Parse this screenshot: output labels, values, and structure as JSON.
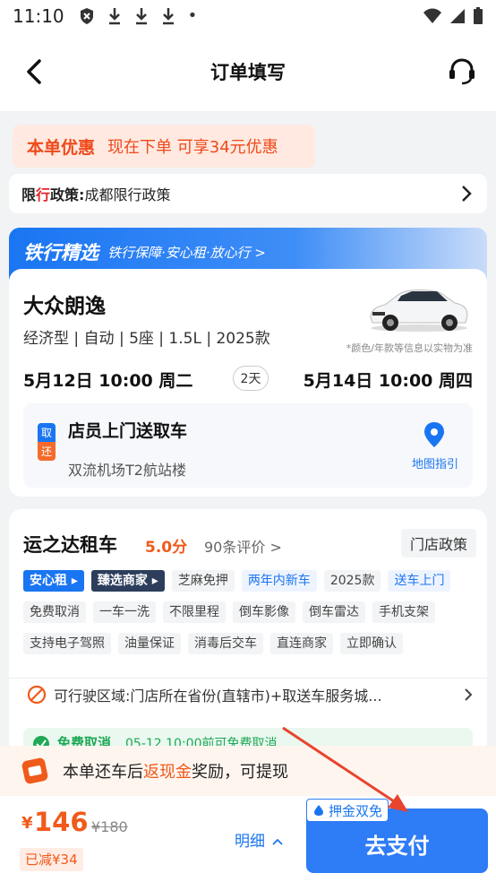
{
  "status": {
    "time": "11:10",
    "dot": "•"
  },
  "nav": {
    "title": "订单填写"
  },
  "promo": {
    "tag": "本单优惠",
    "text": "现在下单 可享34元优惠"
  },
  "policy": {
    "label_pre": "限",
    "label_red": "行",
    "label_post": "政策:",
    "text": "成都限行政策"
  },
  "banner": {
    "title": "铁行精选",
    "subtitle": "铁行保障·安心租·放心行 >"
  },
  "car": {
    "name": "大众朗逸",
    "spec": "经济型 | 自动 | 5座 | 1.5L | 2025款",
    "note": "*颜色/年款等信息以实物为准",
    "pickup_time": "5月12日 10:00 周二",
    "days": "2天",
    "return_time": "5月14日 10:00 周四",
    "pick_label_top": "取",
    "pick_label_bottom": "还",
    "pick_method": "店员上门送取车",
    "pick_location": "双流机场T2航站楼",
    "map_guide": "地图指引"
  },
  "store": {
    "name": "运之达租车",
    "score": "5.0分",
    "reviews": "90条评价 >",
    "policy_button": "门店政策",
    "tags_row1": [
      "安心租 ▸",
      "臻选商家 ▸",
      "芝麻免押",
      "两年内新车",
      "2025款",
      "送车上门"
    ],
    "tags_row2": [
      "免费取消",
      "一车一洗",
      "不限里程",
      "倒车影像",
      "倒车雷达",
      "手机支架"
    ],
    "tags_row3": [
      "支持电子驾照",
      "油量保证",
      "消毒后交车",
      "直连商家",
      "立即确认"
    ],
    "zone": "可行驶区域:门店所在省份(直辖市)+取送车服务城...",
    "free_cancel": "免费取消",
    "free_cancel_sub": "05-12 10:00前可免费取消"
  },
  "cashback": {
    "pre": "本单还车后",
    "highlight": "返现金",
    "post": "奖励，可提现"
  },
  "bottom": {
    "currency": "¥",
    "price": "146",
    "original": "¥180",
    "saved": "已减¥34",
    "detail": "明细",
    "deposit_tag": "押金双免",
    "pay": "去支付"
  },
  "colors": {
    "accent": "#2e7cf6",
    "price": "#f05a1a",
    "promo": "#ee4a1b"
  }
}
